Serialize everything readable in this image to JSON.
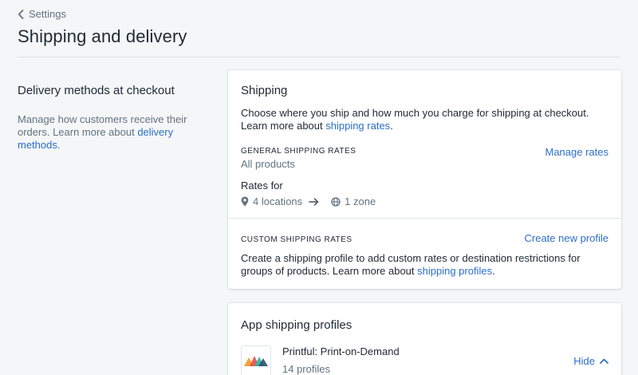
{
  "nav": {
    "back_label": "Settings"
  },
  "page": {
    "title": "Shipping and delivery"
  },
  "section": {
    "title": "Delivery methods at checkout",
    "description": "Manage how customers receive their orders. Learn more about ",
    "link": "delivery methods",
    "suffix": "."
  },
  "shipping_card": {
    "title": "Shipping",
    "description": "Choose where you ship and how much you charge for shipping at checkout. Learn more about ",
    "link": "shipping rates",
    "suffix": ".",
    "general": {
      "heading": "General shipping rates",
      "subtitle": "All products",
      "action": "Manage rates",
      "rates_for": "Rates for",
      "locations": "4 locations",
      "zones": "1 zone"
    },
    "custom": {
      "heading": "Custom shipping rates",
      "action": "Create new profile",
      "description": "Create a shipping profile to add custom rates or destination restrictions for groups of products. Learn more about ",
      "link": "shipping profiles",
      "suffix": "."
    }
  },
  "app_profiles_card": {
    "title": "App shipping profiles",
    "app": {
      "name": "Printful: Print-on-Demand",
      "profiles": "14 profiles",
      "toggle_label": "Hide",
      "logo_colors": [
        "#f2a33a",
        "#e8504c",
        "#2fb39c",
        "#2a4f6e"
      ]
    }
  },
  "colors": {
    "link": "#2c6ecb",
    "background": "#f4f6f8",
    "muted_text": "#637381"
  }
}
